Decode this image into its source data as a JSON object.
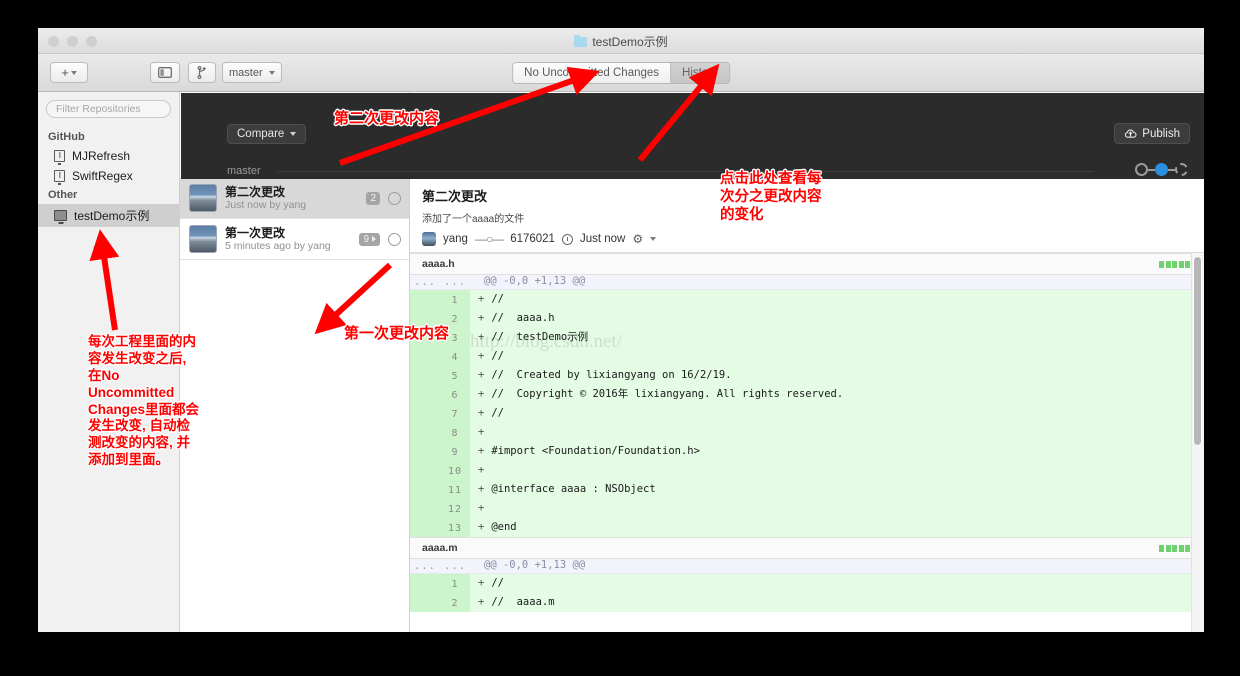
{
  "window": {
    "title": "testDemo示例",
    "folder_icon": "folder-icon",
    "traffic_lights": [
      "close",
      "minimize",
      "maximize"
    ]
  },
  "toolbar": {
    "add_label": "+",
    "add_caret": "chevron-down-icon",
    "sidebar_toggle_icon": "sidebar-toggle-icon",
    "new_branch_icon": "branch-create-icon",
    "branch_label": "master",
    "segments": [
      {
        "label": "No Uncommitted Changes",
        "active": false
      },
      {
        "label": "History",
        "active": true
      }
    ]
  },
  "sidebar": {
    "filter_placeholder": "Filter Repositories",
    "groups": [
      {
        "name": "GitHub",
        "items": [
          {
            "label": "MJRefresh",
            "icon": "book-icon",
            "selected": false
          },
          {
            "label": "SwiftRegex",
            "icon": "book-icon",
            "selected": false
          }
        ]
      },
      {
        "name": "Other",
        "items": [
          {
            "label": "testDemo示例",
            "icon": "monitor-icon",
            "selected": true
          }
        ]
      }
    ]
  },
  "darkbar": {
    "compare_label": "Compare",
    "compare_caret": "chevron-down-icon",
    "branch_lane_label": "master",
    "publish_label": "Publish",
    "publish_icon": "cloud-upload-icon",
    "graph_nodes": [
      "past",
      "current",
      "pending"
    ]
  },
  "commits": [
    {
      "title": "第二次更改",
      "subtitle": "Just now by yang",
      "badge": "2",
      "badge_has_arrow": false,
      "selected": true
    },
    {
      "title": "第一次更改",
      "subtitle": "5 minutes ago by yang",
      "badge": "9",
      "badge_has_arrow": true,
      "selected": false
    }
  ],
  "detail": {
    "title": "第二次更改",
    "description": "添加了一个aaaa的文件",
    "author": "yang",
    "sha": "6176021",
    "time": "Just now",
    "gear_icon": "gear-icon",
    "watermark": "http://blog.csdn.net/",
    "files": [
      {
        "name": "aaaa.h",
        "stat_blocks": 5,
        "hunk": "@@ -0,0 +1,13 @@",
        "lines": [
          {
            "n": "1",
            "text": "//"
          },
          {
            "n": "2",
            "text": "//  aaaa.h"
          },
          {
            "n": "3",
            "text": "//  testDemo示例"
          },
          {
            "n": "4",
            "text": "//"
          },
          {
            "n": "5",
            "text": "//  Created by lixiangyang on 16/2/19."
          },
          {
            "n": "6",
            "text": "//  Copyright © 2016年 lixiangyang. All rights reserved."
          },
          {
            "n": "7",
            "text": "//"
          },
          {
            "n": "8",
            "text": ""
          },
          {
            "n": "9",
            "text": "#import <Foundation/Foundation.h>"
          },
          {
            "n": "10",
            "text": ""
          },
          {
            "n": "11",
            "text": "@interface aaaa : NSObject"
          },
          {
            "n": "12",
            "text": ""
          },
          {
            "n": "13",
            "text": "@end"
          }
        ]
      },
      {
        "name": "aaaa.m",
        "stat_blocks": 5,
        "hunk": "@@ -0,0 +1,13 @@",
        "lines": [
          {
            "n": "1",
            "text": "//"
          },
          {
            "n": "2",
            "text": "//  aaaa.m"
          }
        ]
      }
    ]
  },
  "annotations": {
    "second_change": "第二次更改内容",
    "first_change": "第一次更改内容",
    "click_here": "点击此处查看每\n次分之更改内容\n的变化",
    "left_note": "每次工程里面的内\n容发生改变之后,\n在No\nUncommitted\nChanges里面都会\n发生改变, 自动检\n测改变的内容, 并\n添加到里面。",
    "color": "#ff0000"
  }
}
